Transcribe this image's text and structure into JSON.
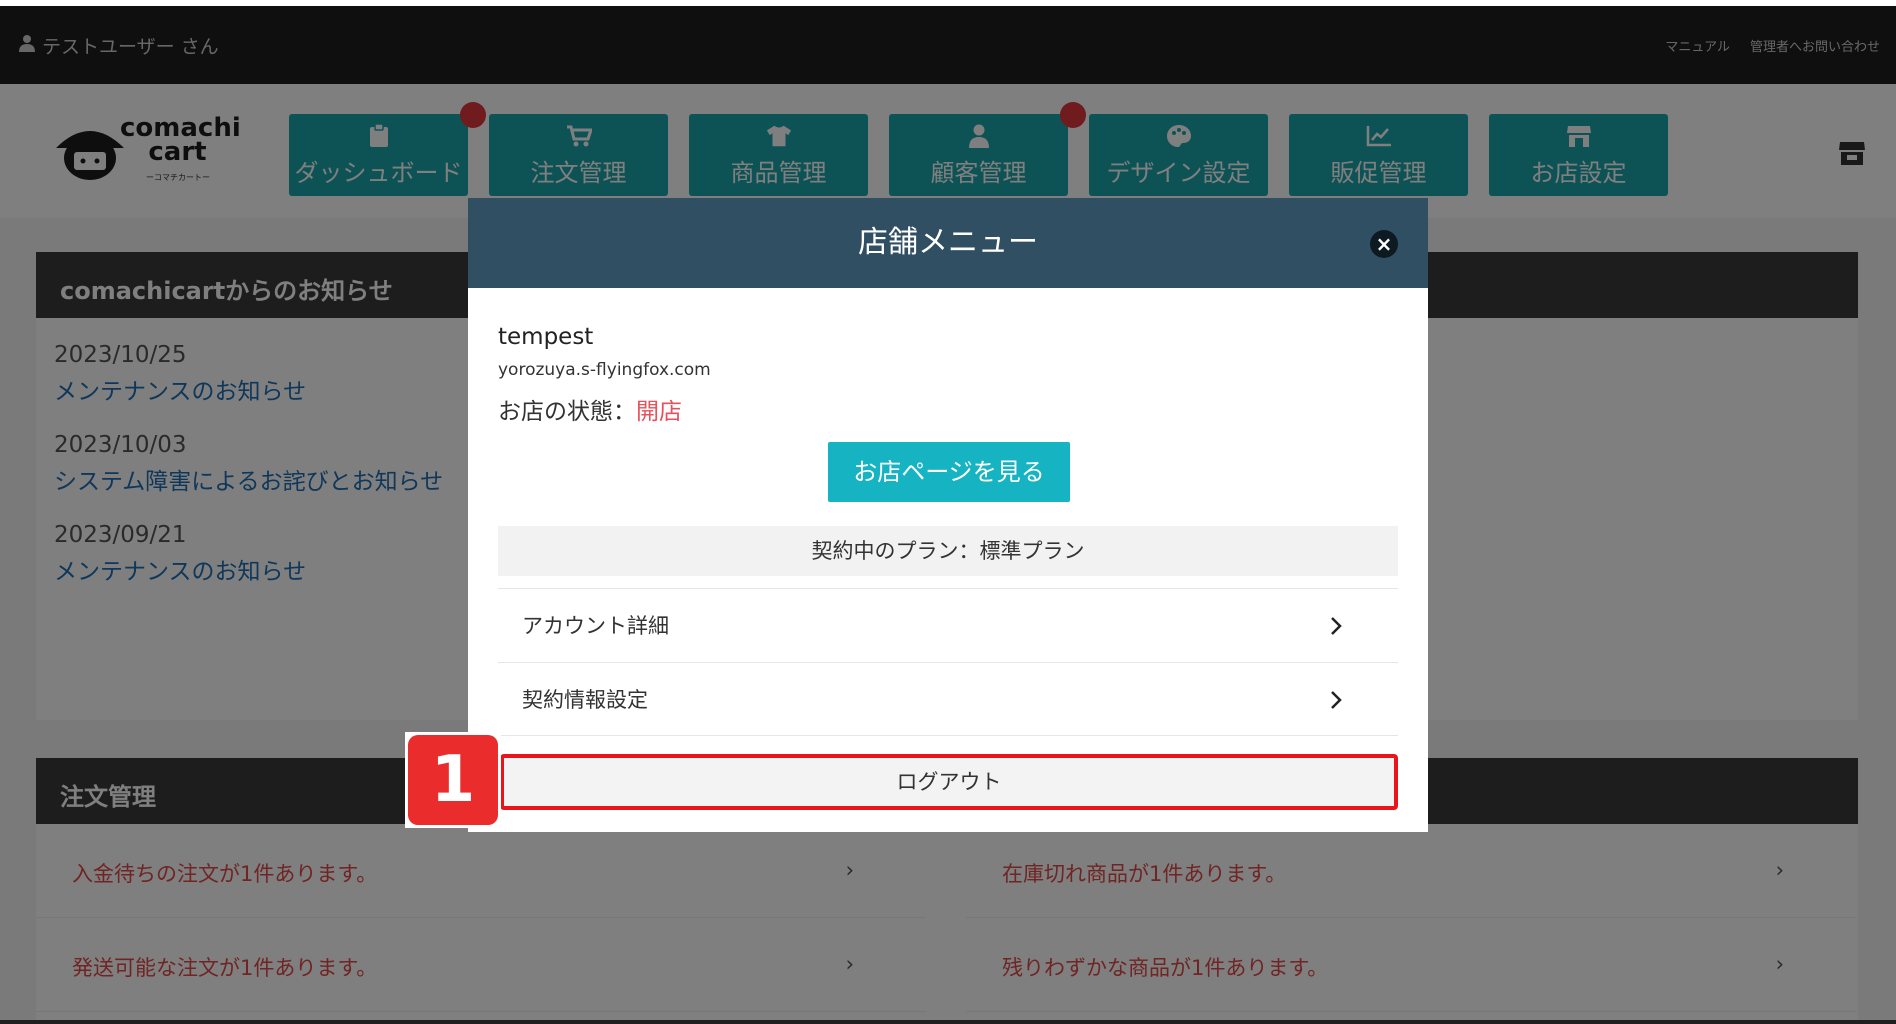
{
  "topbar": {
    "user_label": "テストユーザー さん",
    "links": [
      "マニュアル",
      "管理者へお問い合わせ"
    ]
  },
  "brand": {
    "name_line1": "comachi",
    "name_line2": "cart",
    "tagline": "ーコマチカートー"
  },
  "nav": {
    "items": [
      {
        "label": "ダッシュボード",
        "icon": "clipboard-icon",
        "badge": true
      },
      {
        "label": "注文管理",
        "icon": "cart-icon",
        "badge": false
      },
      {
        "label": "商品管理",
        "icon": "shirt-icon",
        "badge": false
      },
      {
        "label": "顧客管理",
        "icon": "user-icon",
        "badge": true
      },
      {
        "label": "デザイン設定",
        "icon": "palette-icon",
        "badge": false
      },
      {
        "label": "販促管理",
        "icon": "chart-line-icon",
        "badge": false
      },
      {
        "label": "お店設定",
        "icon": "store-icon",
        "badge": false
      }
    ]
  },
  "news": {
    "title": "comachicartからのお知らせ",
    "items": [
      {
        "date": "2023/10/25",
        "title": "メンテナンスのお知らせ"
      },
      {
        "date": "2023/10/03",
        "title": "システム障害によるお詫びとお知らせ"
      },
      {
        "date": "2023/09/21",
        "title": "メンテナンスのお知らせ"
      }
    ]
  },
  "orders": {
    "title": "注文管理",
    "left": [
      "入金待ちの注文が1件あります。",
      "発送可能な注文が1件あります。"
    ],
    "right": [
      "在庫切れ商品が1件あります。",
      "残りわずかな商品が1件あります。"
    ]
  },
  "modal": {
    "title": "店舗メニュー",
    "close": "×",
    "shop_name": "tempest",
    "shop_url": "yorozuya.s-flyingfox.com",
    "status_label": "お店の状態：",
    "status_value": "開店",
    "view_button": "お店ページを見る",
    "plan": "契約中のプラン：標準プラン",
    "menu": [
      {
        "label": "アカウント詳細"
      },
      {
        "label": "契約情報設定"
      }
    ],
    "logout": "ログアウト"
  },
  "step_marker": "1",
  "colors": {
    "teal": "#1aa6ad",
    "modal_header": "#314f63",
    "view_button": "#16b4c3",
    "highlight": "#e9151b",
    "status_open": "#e8505b"
  }
}
